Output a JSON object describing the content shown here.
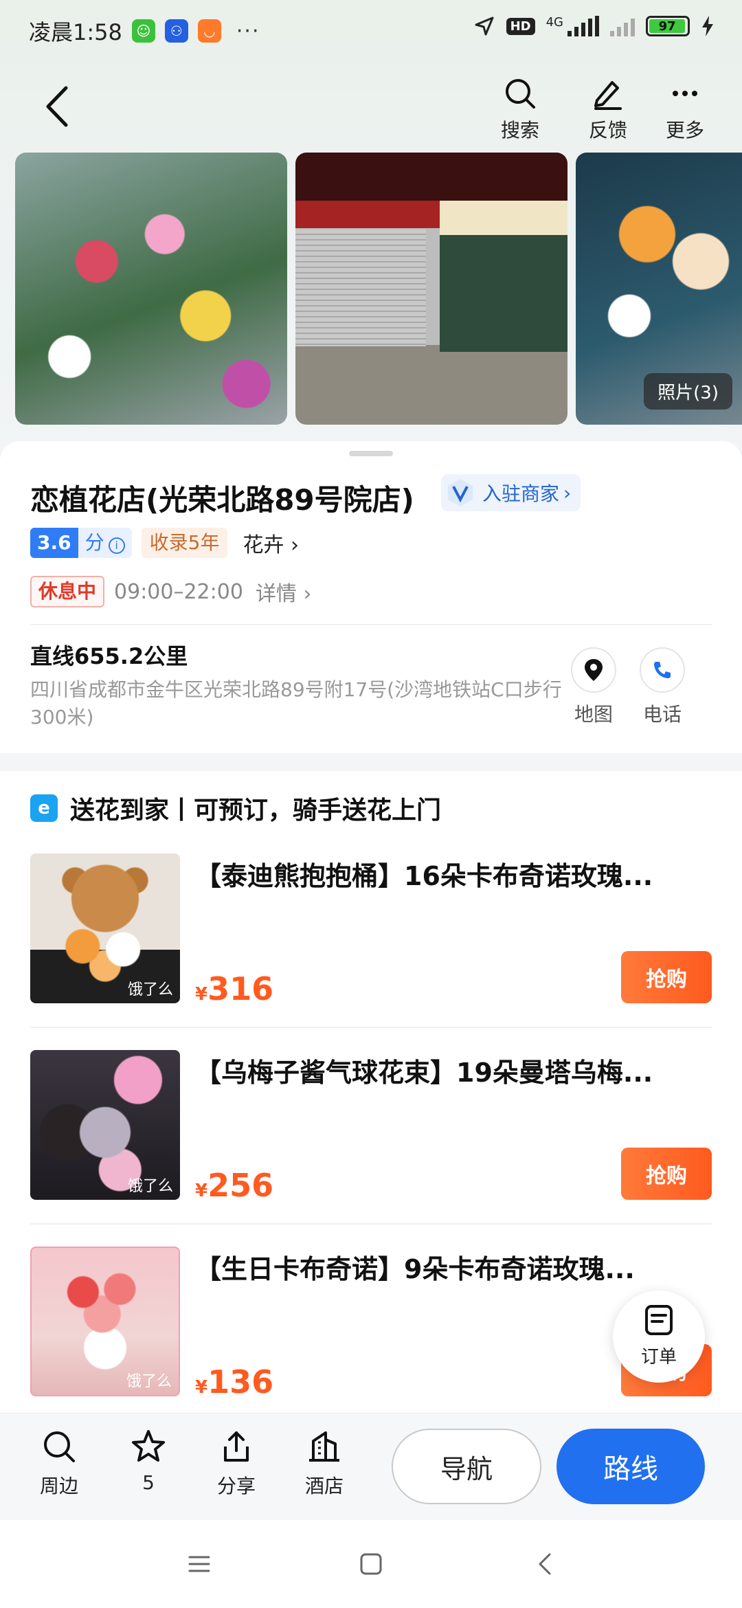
{
  "status_bar": {
    "time": "凌晨1:58",
    "more": "···",
    "network": "4G",
    "hd": "HD",
    "battery": "97",
    "battery_level": 0.97
  },
  "header": {
    "back": "back",
    "actions": [
      {
        "label": "搜索",
        "icon": "search-icon"
      },
      {
        "label": "反馈",
        "icon": "edit-icon"
      },
      {
        "label": "更多",
        "icon": "more-icon"
      }
    ]
  },
  "photos": {
    "count_label": "照片(3)"
  },
  "shop": {
    "name": "恋植花店(光荣北路89号院店)",
    "merchant_label": "入驻商家",
    "merchant_arrow": "›",
    "score": "3.6",
    "score_unit": "分",
    "years_tag": "收录5年",
    "category": "花卉",
    "status": "休息中",
    "hours": "09:00–22:00",
    "detail": "详情",
    "distance": "直线655.2公里",
    "address": "四川省成都市金牛区光荣北路89号附17号(沙湾地铁站C口步行300米)",
    "map_label": "地图",
    "phone_label": "电话"
  },
  "delivery": {
    "title": "送花到家丨可预订，骑手送花上门",
    "products": [
      {
        "title": "【泰迪熊抱抱桶】16朵卡布奇诺玫瑰...",
        "price_symbol": "¥",
        "price": "316",
        "source": "饿了么",
        "buy": "抢购"
      },
      {
        "title": "【乌梅子酱气球花束】19朵曼塔乌梅...",
        "price_symbol": "¥",
        "price": "256",
        "source": "饿了么",
        "buy": "抢购"
      },
      {
        "title": "【生日卡布奇诺】9朵卡布奇诺玫瑰...",
        "price_symbol": "¥",
        "price": "136",
        "source": "饿了么",
        "buy": "抢购"
      }
    ]
  },
  "order_fab": {
    "label": "订单"
  },
  "bottom_bar": {
    "nearby": "周边",
    "favorites": "5",
    "share": "分享",
    "hotel": "酒店",
    "navigate": "导航",
    "route": "路线"
  },
  "colors": {
    "accent_blue": "#2170f0",
    "price_orange": "#ff5a1f",
    "closed_red": "#e03a2a"
  }
}
